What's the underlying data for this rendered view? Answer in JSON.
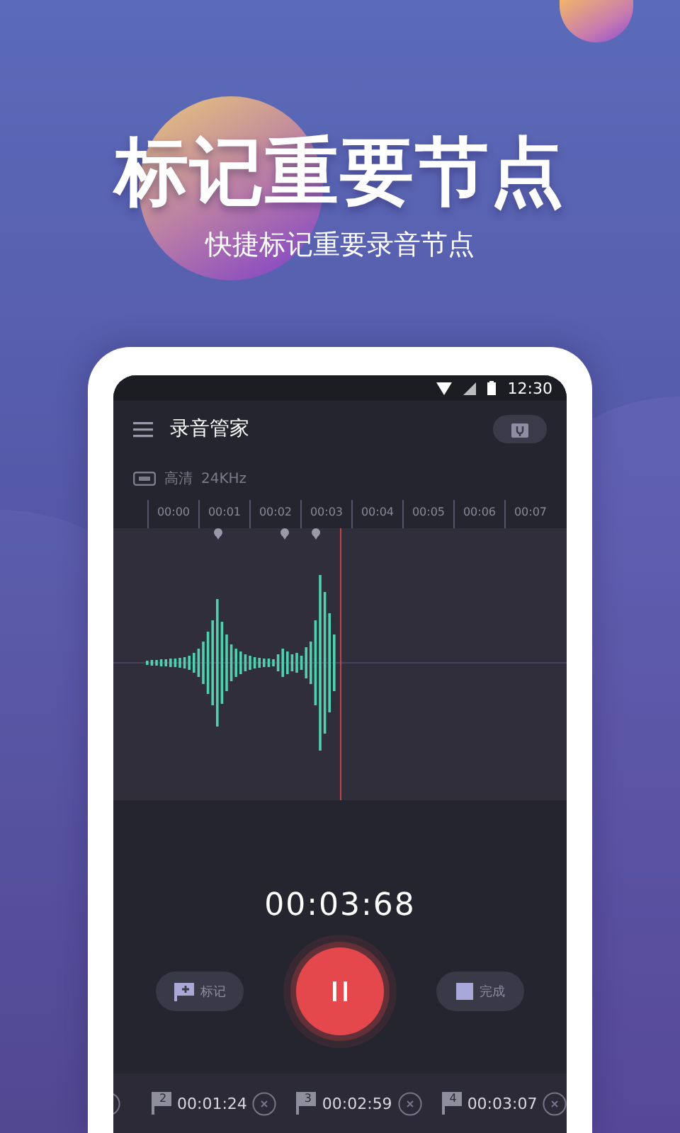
{
  "headline": "标记重要节点",
  "subtitle": "快捷标记重要录音节点",
  "status_bar": {
    "time": "12:30"
  },
  "app_bar": {
    "title": "录音管家"
  },
  "recording_info": {
    "quality": "高清",
    "sample_rate": "24KHz"
  },
  "timeline": {
    "labels": [
      "00:00",
      "00:01",
      "00:02",
      "00:03",
      "00:04",
      "00:05",
      "00:06",
      "00:07"
    ]
  },
  "timer": "00:03:68",
  "controls": {
    "mark_label": "标记",
    "done_label": "完成"
  },
  "markers": [
    {
      "number": "2",
      "time": "00:01:24"
    },
    {
      "number": "3",
      "time": "00:02:59"
    },
    {
      "number": "4",
      "time": "00:03:07"
    }
  ]
}
